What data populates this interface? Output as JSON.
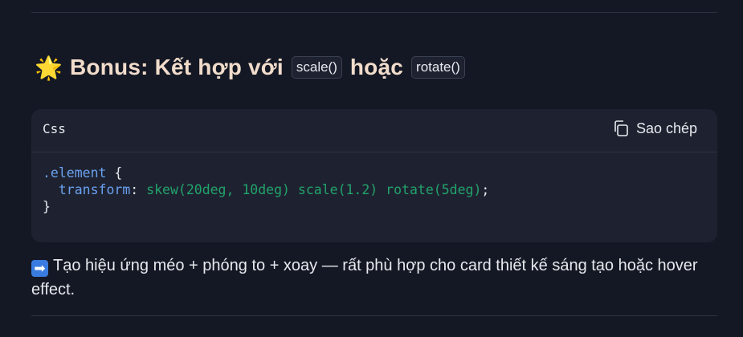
{
  "heading": {
    "emoji": "🌟",
    "text_before": "Bonus: Kết hợp với",
    "code1": "scale()",
    "text_middle": "hoặc",
    "code2": "rotate()"
  },
  "code_block": {
    "language": "Css",
    "copy_label": "Sao chép",
    "lines": {
      "selector": ".element",
      "open_brace": " {",
      "indent": "  ",
      "property": "transform",
      "colon": ": ",
      "value": "skew(20deg, 10deg) scale(1.2) rotate(5deg)",
      "semicolon": ";",
      "close_brace": "}"
    }
  },
  "paragraph": {
    "arrow_icon": "➡",
    "text": "Tạo hiệu ứng méo + phóng to + xoay — rất phù hợp cho card thiết kế sáng tạo hoặc hover effect."
  },
  "colors": {
    "background": "#141824",
    "heading": "#f1dccb",
    "code_bg": "#1e2230",
    "selector": "#6aa0f0",
    "value": "#22a36b"
  }
}
